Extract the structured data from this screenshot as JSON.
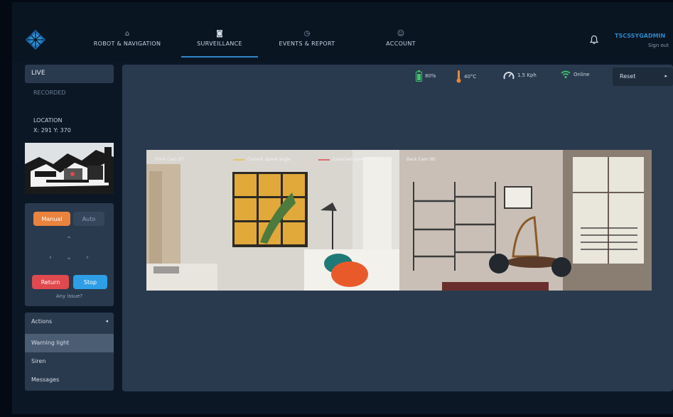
{
  "nav": {
    "tabs": [
      {
        "label": "ROBOT & NAVIGATION",
        "icon": "robot-icon"
      },
      {
        "label": "SURVEILLANCE",
        "icon": "camera-icon",
        "active": true
      },
      {
        "label": "EVENTS & REPORT",
        "icon": "clock-icon"
      },
      {
        "label": "ACCOUNT",
        "icon": "user-icon"
      }
    ],
    "user_name": "TSCSSYGADMIN",
    "user_sub": "Sign out"
  },
  "sidebar": {
    "live_label": "LIVE",
    "recorded_label": "RECORDED",
    "location_title": "LOCATION",
    "location_xy": "X: 291   Y: 370",
    "control": {
      "manual_label": "Manual",
      "auto_label": "Auto",
      "return_label": "Return",
      "stop_label": "Stop",
      "help_text": "Any issue?"
    },
    "actions": {
      "header": "Actions",
      "items": [
        "Warning light",
        "Siren",
        "Messages"
      ]
    }
  },
  "status": {
    "battery": "80%",
    "temperature": "40°C",
    "speed": "1.5 Kph",
    "connection": "Online"
  },
  "reset_label": "Reset",
  "cameras": {
    "front_label": "Front Cam (F)",
    "legend_current": "Current speed angle",
    "legend_expected": "Expected speed angle",
    "back_label": "Back Cam (B)"
  },
  "colors": {
    "accent": "#2f86c8",
    "manual": "#e9833e",
    "return": "#e0494e",
    "stop": "#2e9ee6",
    "battery": "#3fc46a",
    "temperature": "#e58a3a",
    "wifi": "#3fc46a",
    "legend_current": "#e8c03a",
    "legend_expected": "#e0494e"
  }
}
